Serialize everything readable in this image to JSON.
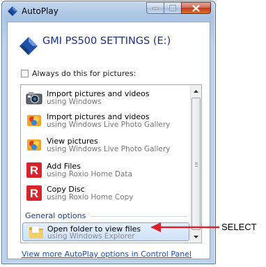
{
  "window": {
    "title": "AutoPlay",
    "device_title": "GMI PS500 SETTINGS (E:)",
    "always_checkbox_label": "Always do this for pictures:",
    "always_checked": false
  },
  "list": {
    "items": [
      {
        "title": "Import pictures and videos",
        "subtitle": "using Windows",
        "icon": "camera-icon"
      },
      {
        "title": "Import pictures and videos",
        "subtitle": "using Windows Live Photo Gallery",
        "icon": "photo-gallery-icon"
      },
      {
        "title": "View pictures",
        "subtitle": "using Windows Live Photo Gallery",
        "icon": "photo-gallery-icon"
      },
      {
        "title": "Add Files",
        "subtitle": "using Roxio Home Data",
        "icon": "roxio-icon"
      },
      {
        "title": "Copy Disc",
        "subtitle": "using Roxio Home Copy",
        "icon": "roxio-icon"
      }
    ],
    "group_label": "General options",
    "selected_item": {
      "title": "Open folder to view files",
      "subtitle": "using Windows Explorer",
      "icon": "folder-icon"
    }
  },
  "link_text": "View more AutoPlay options in Control Panel",
  "annotation": {
    "label": "SELECT",
    "color": "#d9232e"
  }
}
